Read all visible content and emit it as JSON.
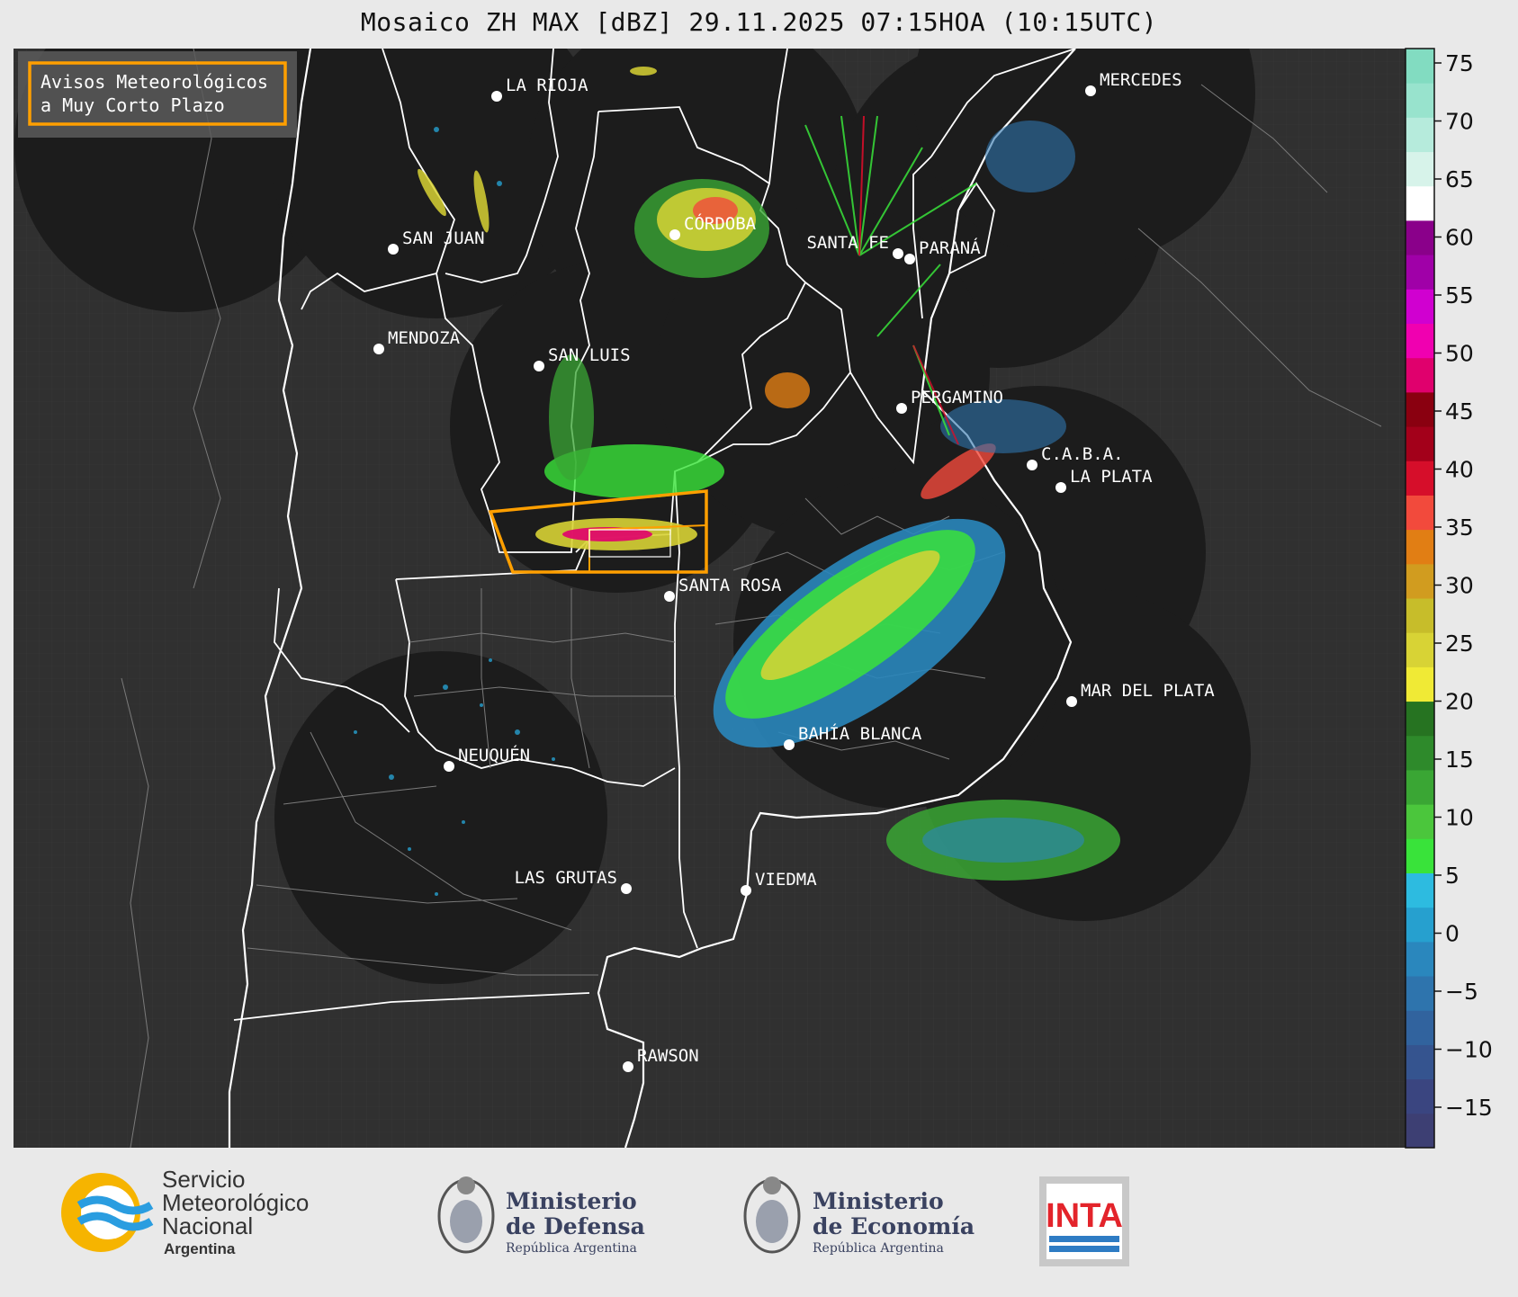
{
  "title": "Mosaico ZH MAX [dBZ] 29.11.2025 07:15HOA (10:15UTC)",
  "legend_box": {
    "line1": "Avisos Meteorológicos",
    "line2": "a Muy Corto Plazo",
    "border_color": "#ff9f00"
  },
  "colorbar": {
    "ticks": [
      "75",
      "70",
      "65",
      "60",
      "55",
      "50",
      "45",
      "40",
      "35",
      "30",
      "25",
      "20",
      "15",
      "10",
      "5",
      "0",
      "−5",
      "−10",
      "−15"
    ],
    "colors": [
      "#3d3f73",
      "#3a4580",
      "#35548f",
      "#31639e",
      "#2e74ad",
      "#2a87bd",
      "#26a0cf",
      "#2dbbe0",
      "#39e33a",
      "#4bc63c",
      "#3aa634",
      "#2e8a2b",
      "#267321",
      "#f0ea35",
      "#d8d335",
      "#c7bd2a",
      "#d19c1f",
      "#e17e14",
      "#f24a3c",
      "#d60e2a",
      "#a3001a",
      "#8a0010",
      "#e0006d",
      "#f000b0",
      "#d000d0",
      "#a000a8",
      "#8a008a",
      "#ffffff",
      "#d7f3ea",
      "#b6ebdc",
      "#98e3cd",
      "#82dcc1"
    ]
  },
  "cities": [
    {
      "name": "LA RIOJA"
    },
    {
      "name": "MERCEDES"
    },
    {
      "name": "CÓRDOBA"
    },
    {
      "name": "SAN JUAN"
    },
    {
      "name": "SANTA FE"
    },
    {
      "name": "PARANÁ"
    },
    {
      "name": "MENDOZA"
    },
    {
      "name": "SAN LUIS"
    },
    {
      "name": "PERGAMINO"
    },
    {
      "name": "C.A.B.A."
    },
    {
      "name": "LA PLATA"
    },
    {
      "name": "SANTA ROSA"
    },
    {
      "name": "MAR DEL PLATA"
    },
    {
      "name": "BAHÍA BLANCA"
    },
    {
      "name": "NEUQUÉN"
    },
    {
      "name": "LAS GRUTAS"
    },
    {
      "name": "VIEDMA"
    },
    {
      "name": "RAWSON"
    }
  ],
  "logos": {
    "smn": {
      "line1": "Servicio",
      "line2": "Meteorológico",
      "line3": "Nacional",
      "line4": "Argentina"
    },
    "defensa": {
      "line1": "Ministerio",
      "line2": "de Defensa",
      "line3": "República Argentina"
    },
    "economia": {
      "line1": "Ministerio",
      "line2": "de Economía",
      "line3": "República Argentina"
    },
    "inta": {
      "text": "INTA"
    }
  }
}
